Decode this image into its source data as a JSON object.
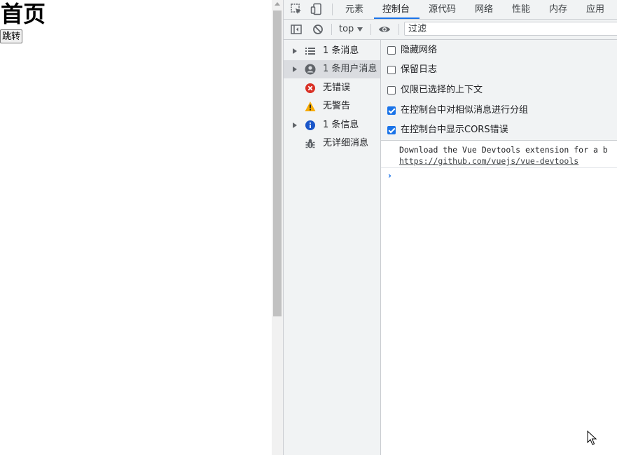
{
  "page": {
    "title": "首页",
    "button_label": "跳转"
  },
  "devtools": {
    "tabs": [
      {
        "label": "元素",
        "active": false
      },
      {
        "label": "控制台",
        "active": true
      },
      {
        "label": "源代码",
        "active": false
      },
      {
        "label": "网络",
        "active": false
      },
      {
        "label": "性能",
        "active": false
      },
      {
        "label": "内存",
        "active": false
      },
      {
        "label": "应用",
        "active": false
      }
    ],
    "toolbar": {
      "context": "top",
      "filter_placeholder": "过滤"
    },
    "sidebar": {
      "items": [
        {
          "label": "1 条消息",
          "icon": "list-icon",
          "expandable": true,
          "selected": false
        },
        {
          "label": "1 条用户消息",
          "icon": "user-icon",
          "expandable": true,
          "selected": true
        },
        {
          "label": "无错误",
          "icon": "error-icon",
          "expandable": false,
          "selected": false
        },
        {
          "label": "无警告",
          "icon": "warning-icon",
          "expandable": false,
          "selected": false
        },
        {
          "label": "1 条信息",
          "icon": "info-icon",
          "expandable": true,
          "selected": false
        },
        {
          "label": "无详细消息",
          "icon": "bug-icon",
          "expandable": false,
          "selected": false
        }
      ]
    },
    "settings": [
      {
        "label": "隐藏网络",
        "checked": false
      },
      {
        "label": "保留日志",
        "checked": false
      },
      {
        "label": "仅限已选择的上下文",
        "checked": false
      },
      {
        "label": "在控制台中对相似消息进行分组",
        "checked": true
      },
      {
        "label": "在控制台中显示CORS错误",
        "checked": true
      }
    ],
    "console": {
      "message": "Download the Vue Devtools extension for a b",
      "link": "https://github.com/vuejs/vue-devtools",
      "prompt": "›"
    },
    "colors": {
      "accent": "#1a73e8",
      "error": "#d93025",
      "warning": "#f9ab00",
      "info": "#1a73e8",
      "panel_bg": "#f1f3f4"
    }
  }
}
